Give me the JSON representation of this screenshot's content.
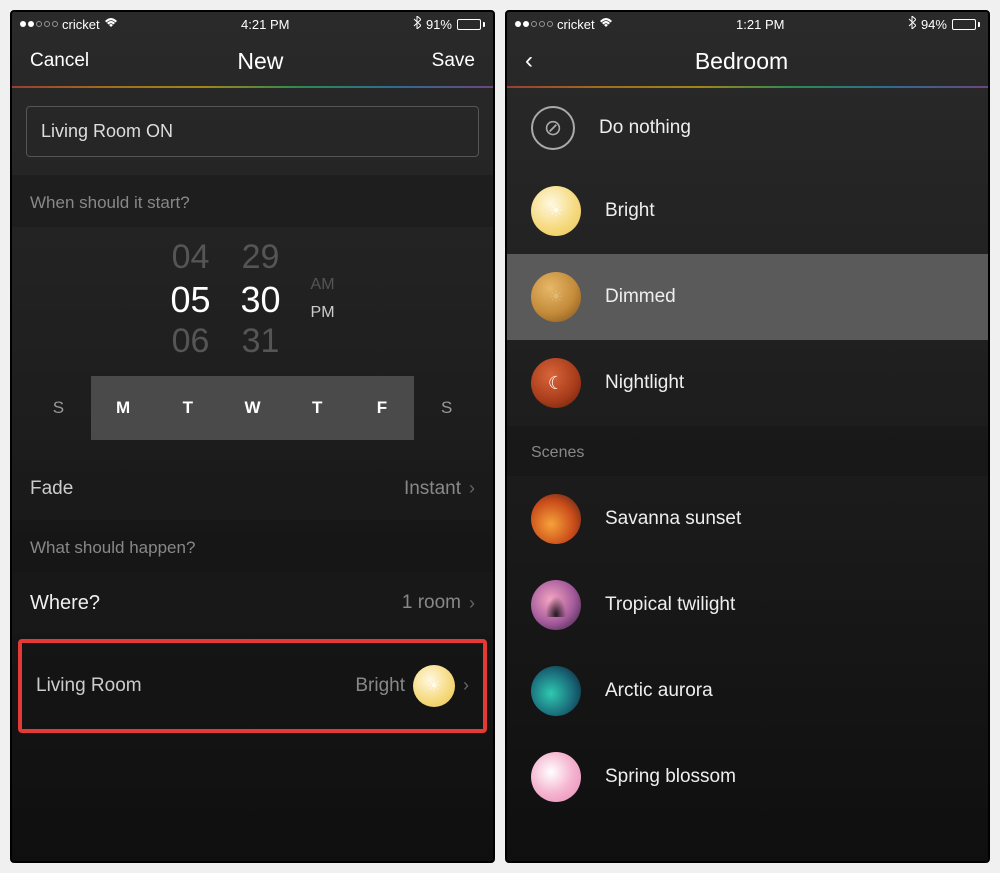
{
  "left": {
    "status": {
      "carrier": "cricket",
      "time": "4:21 PM",
      "battery_pct": "91%",
      "battery_fill": 91
    },
    "nav": {
      "cancel": "Cancel",
      "title": "New",
      "save": "Save"
    },
    "name_input": "Living Room ON",
    "section_when": "When should it start?",
    "picker": {
      "hour_prev": "04",
      "hour": "05",
      "hour_next": "06",
      "min_prev": "29",
      "min": "30",
      "min_next": "31",
      "am": "AM",
      "pm": "PM"
    },
    "days": [
      {
        "label": "S",
        "selected": false
      },
      {
        "label": "M",
        "selected": true
      },
      {
        "label": "T",
        "selected": true
      },
      {
        "label": "W",
        "selected": true
      },
      {
        "label": "T",
        "selected": true
      },
      {
        "label": "F",
        "selected": true
      },
      {
        "label": "S",
        "selected": false
      }
    ],
    "fade_label": "Fade",
    "fade_value": "Instant",
    "section_what": "What should happen?",
    "where_label": "Where?",
    "where_value": "1 room",
    "room_name": "Living Room",
    "room_scene": "Bright"
  },
  "right": {
    "status": {
      "carrier": "cricket",
      "time": "1:21 PM",
      "battery_pct": "94%",
      "battery_fill": 94
    },
    "nav": {
      "title": "Bedroom"
    },
    "presets": [
      {
        "label": "Do nothing",
        "kind": "none",
        "selected": false
      },
      {
        "label": "Bright",
        "kind": "bright",
        "selected": false
      },
      {
        "label": "Dimmed",
        "kind": "dimmed",
        "selected": true
      },
      {
        "label": "Nightlight",
        "kind": "night",
        "selected": false
      }
    ],
    "scenes_header": "Scenes",
    "scenes": [
      {
        "label": "Savanna sunset",
        "kind": "savanna"
      },
      {
        "label": "Tropical twilight",
        "kind": "tropical"
      },
      {
        "label": "Arctic aurora",
        "kind": "arctic"
      },
      {
        "label": "Spring blossom",
        "kind": "spring"
      }
    ]
  }
}
